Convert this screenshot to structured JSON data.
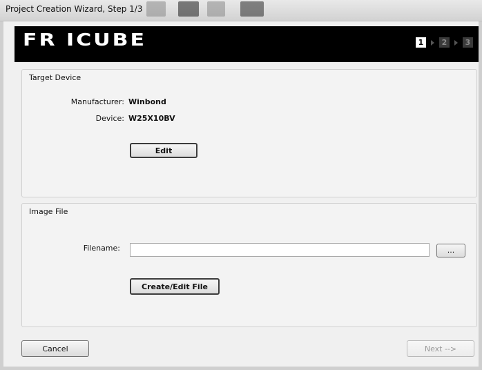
{
  "window": {
    "title": "Project Creation Wizard, Step 1/3"
  },
  "banner": {
    "logo_text": "FR ICUBE",
    "steps": [
      "1",
      "2",
      "3"
    ],
    "active_step": "1"
  },
  "target_device": {
    "group_title": "Target Device",
    "manufacturer_label": "Manufacturer:",
    "manufacturer_value": "Winbond",
    "device_label": "Device:",
    "device_value": "W25X10BV",
    "edit_label": "Edit"
  },
  "image_file": {
    "group_title": "Image File",
    "filename_label": "Filename:",
    "filename_value": "",
    "browse_label": "...",
    "create_edit_label": "Create/Edit File"
  },
  "footer": {
    "cancel_label": "Cancel",
    "next_label": "Next -->"
  }
}
